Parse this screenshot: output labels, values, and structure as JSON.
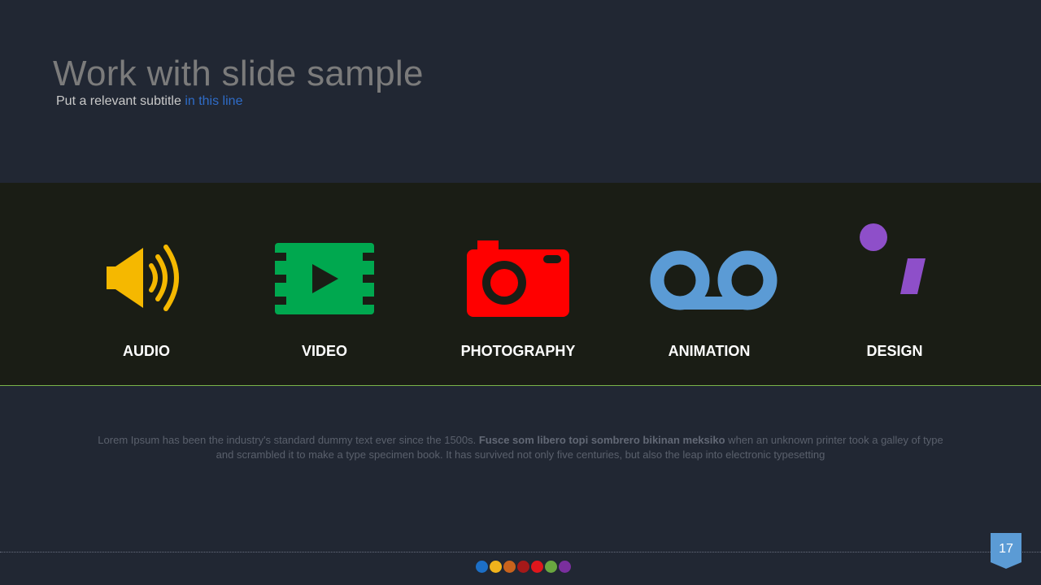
{
  "header": {
    "title": "Work with slide sample",
    "subtitle_plain": "Put a relevant subtitle ",
    "subtitle_accent": "in this line"
  },
  "services": [
    {
      "label": "AUDIO",
      "icon": "speaker-icon",
      "color": "#f5b800"
    },
    {
      "label": "VIDEO",
      "icon": "film-play-icon",
      "color": "#00a84f"
    },
    {
      "label": "PHOTOGRAPHY",
      "icon": "camera-icon",
      "color": "#ff0000"
    },
    {
      "label": "ANIMATION",
      "icon": "voicemail-icon",
      "color": "#5b9bd5"
    },
    {
      "label": "DESIGN",
      "icon": "info-icon",
      "color": "#8e4fc9"
    }
  ],
  "body": {
    "text_before": "Lorem Ipsum has been the industry's standard dummy text ever since the 1500s. ",
    "text_bold": "Fusce som libero topi sombrero bikinan meksiko",
    "text_after": " when an unknown printer took a galley of type and scrambled it to make a type specimen book. It has survived not only five centuries, but also the leap into electronic typesetting"
  },
  "footer": {
    "page_number": "17",
    "dot_colors": [
      "#1c6fc7",
      "#f0b31c",
      "#c9631c",
      "#a51919",
      "#e0161c",
      "#6aa640",
      "#7a2f9e"
    ]
  }
}
